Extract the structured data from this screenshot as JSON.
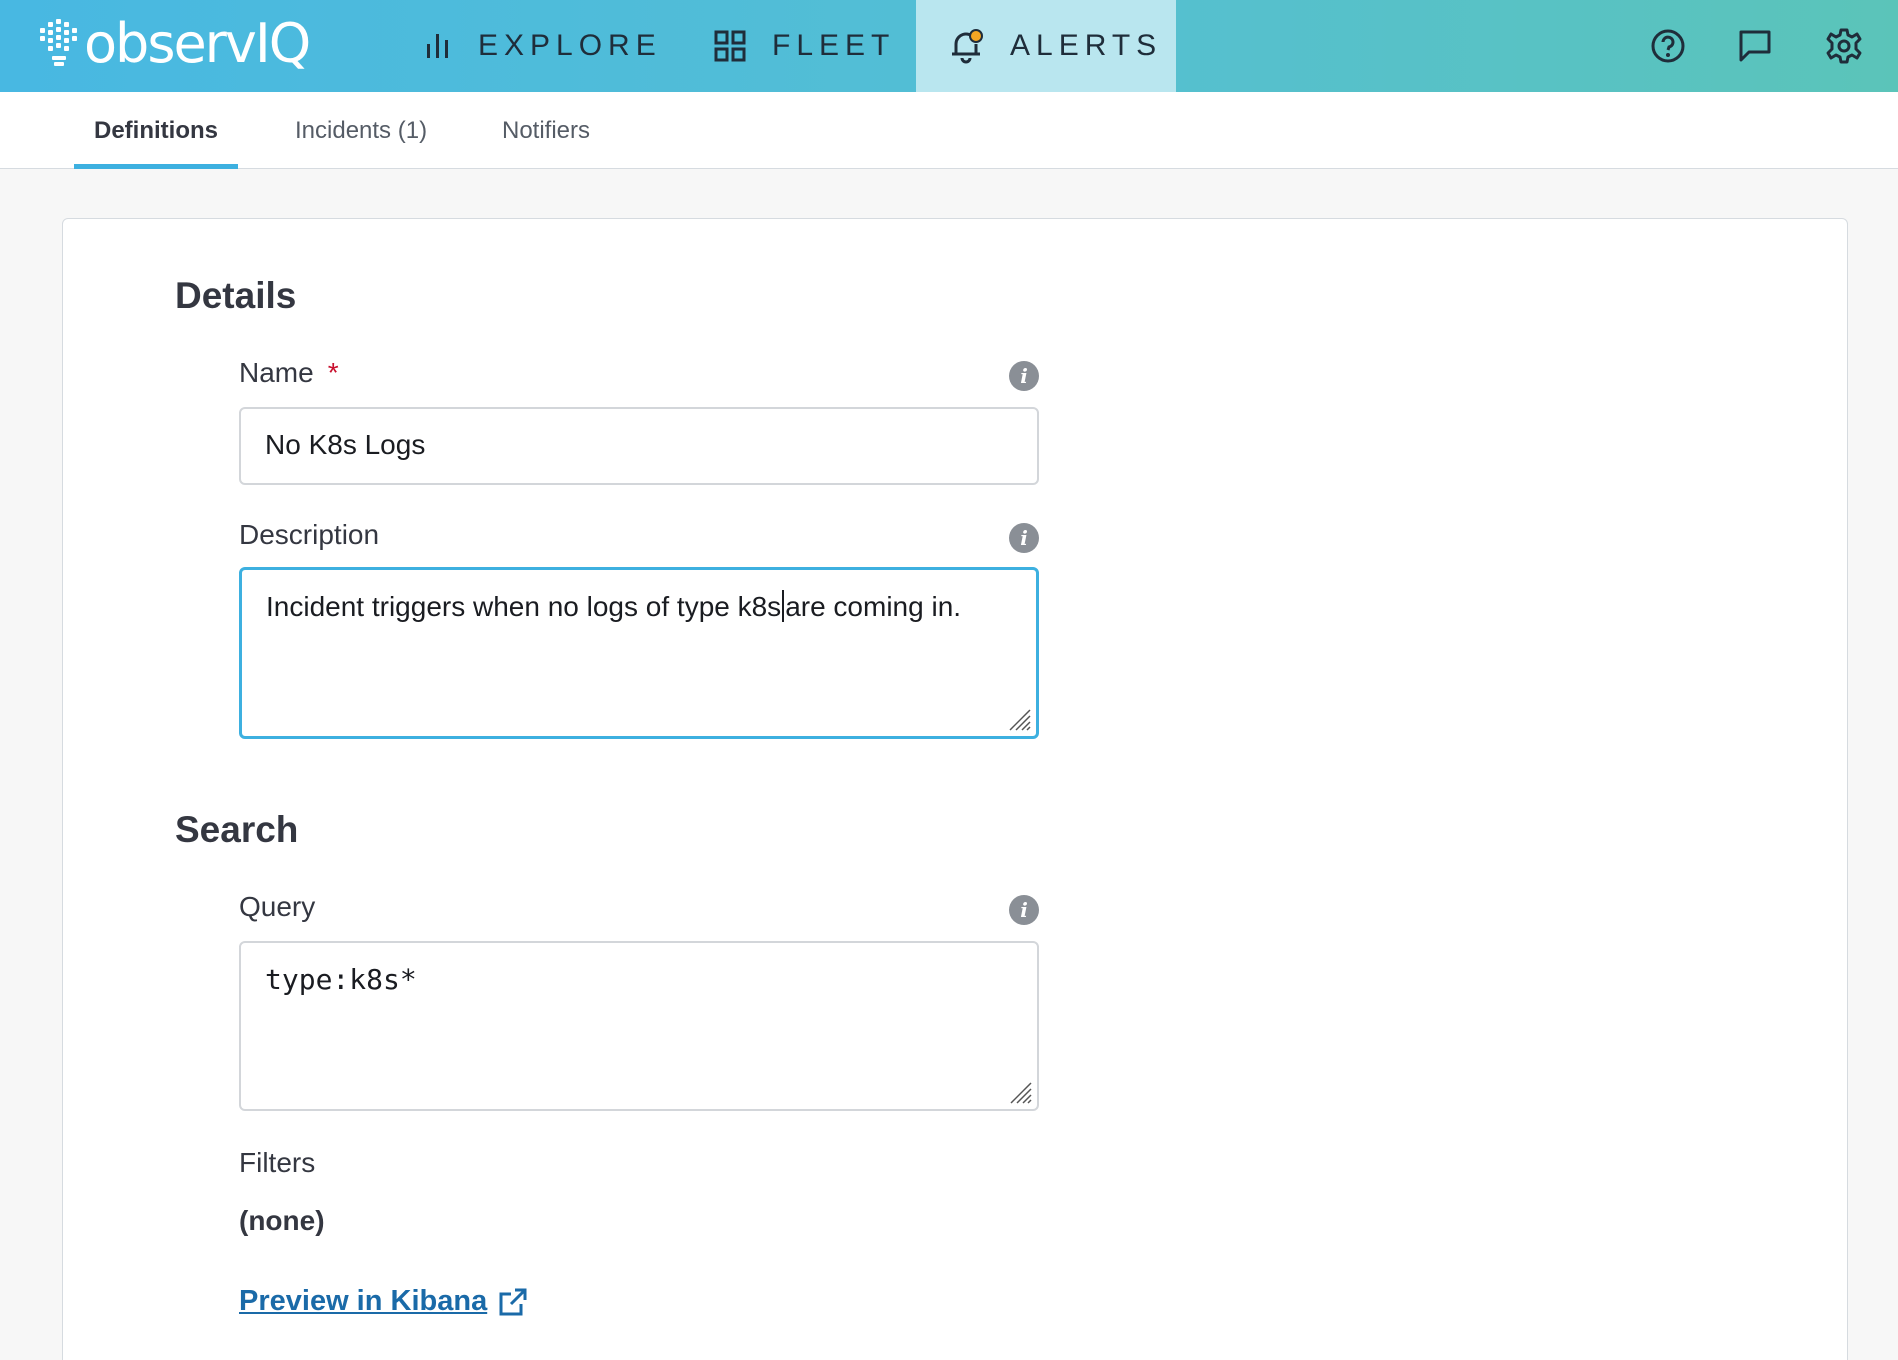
{
  "brand": {
    "logo_text": "observIQ"
  },
  "topnav": {
    "items": [
      {
        "label": "EXPLORE",
        "icon": "bar-chart-icon"
      },
      {
        "label": "FLEET",
        "icon": "grid-icon"
      },
      {
        "label": "ALERTS",
        "icon": "bell-icon",
        "active": true
      }
    ],
    "right_icons": [
      "help-icon",
      "feedback-icon",
      "settings-icon"
    ]
  },
  "subtabs": [
    {
      "label": "Definitions",
      "active": true
    },
    {
      "label": "Incidents (1)"
    },
    {
      "label": "Notifiers"
    }
  ],
  "details": {
    "title": "Details",
    "name_label": "Name",
    "name_required_mark": "*",
    "name_value": "No K8s Logs",
    "description_label": "Description",
    "description_before_caret": "Incident triggers when no logs of type k8s",
    "description_after_caret": "are coming in."
  },
  "search": {
    "title": "Search",
    "query_label": "Query",
    "query_value": "type:k8s*",
    "filters_label": "Filters",
    "filters_value": "(none)",
    "preview_link": "Preview in Kibana"
  },
  "colors": {
    "nav_gradient_start": "#48b8e2",
    "nav_gradient_end": "#5bc4b9",
    "active_nav": "#b9e6ef",
    "accent": "#3db0e0",
    "link": "#1a6aa8",
    "required": "#c8102e"
  }
}
